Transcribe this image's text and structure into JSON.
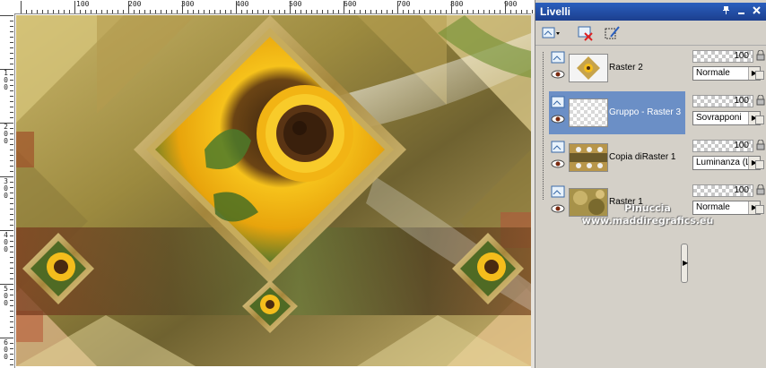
{
  "ruler": {
    "h_labels": [
      "100",
      "200",
      "300",
      "400",
      "500",
      "600",
      "700",
      "800",
      "900"
    ],
    "v_labels": [
      "1\n0\n0",
      "2\n0\n0",
      "3\n0\n0",
      "4\n0\n0",
      "5\n0\n0",
      "6\n0\n0"
    ]
  },
  "palette": {
    "title": "Livelli"
  },
  "layers": [
    {
      "name": "Raster 2",
      "opacity": "100",
      "blend": "Normale",
      "selected": false
    },
    {
      "name": "Gruppo - Raster 3",
      "opacity": "100",
      "blend": "Sovrapponi",
      "selected": true
    },
    {
      "name": "Copia diRaster 1",
      "opacity": "100",
      "blend": "Luminanza (L)",
      "selected": false
    },
    {
      "name": "Raster 1",
      "opacity": "100",
      "blend": "Normale",
      "selected": false
    }
  ],
  "watermark": {
    "line1": "Pinuccia",
    "line2": "www.maddiregrafics.eu"
  },
  "colors": {
    "selection": "#6b8fc6",
    "title_bar": "#2a5fbe"
  }
}
